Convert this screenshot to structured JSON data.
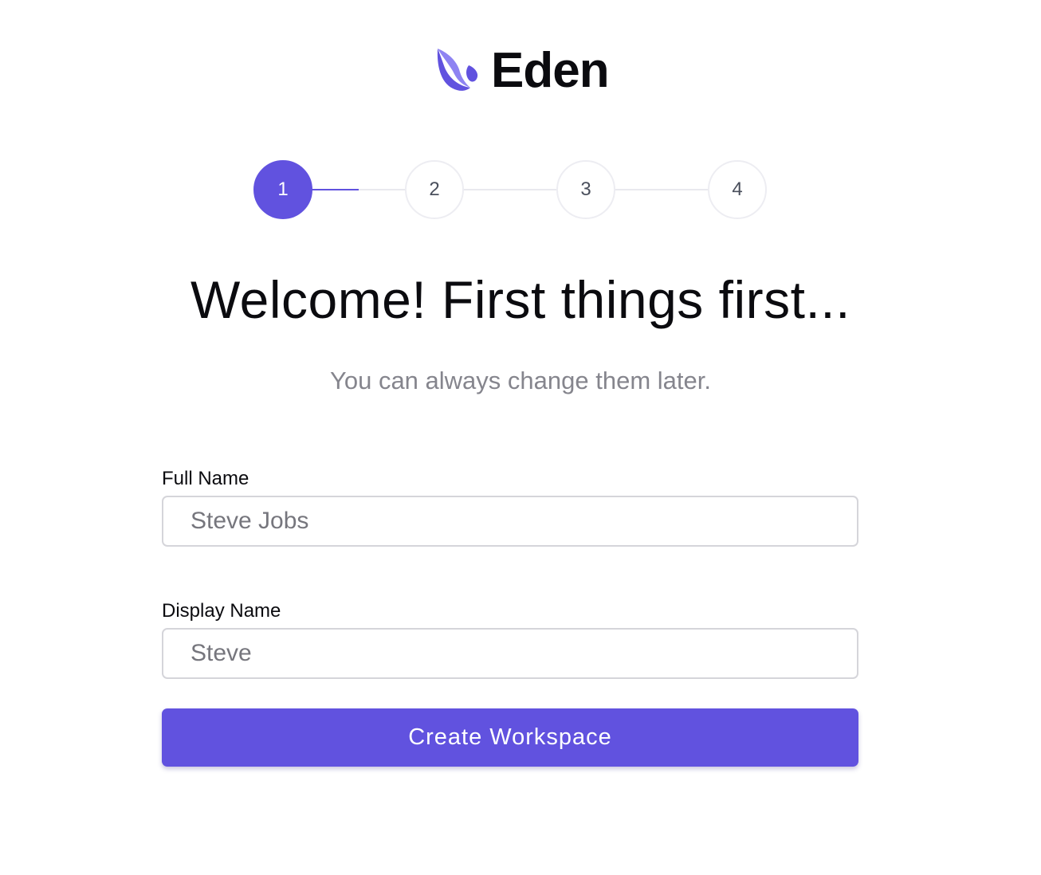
{
  "brand": {
    "name": "Eden",
    "logo_icon": "eden-leaf-icon",
    "accent_color": "#6152df"
  },
  "stepper": {
    "steps": [
      "1",
      "2",
      "3",
      "4"
    ],
    "current_step": 1
  },
  "heading": "Welcome! First things first...",
  "subtitle": "You can always change them later.",
  "form": {
    "full_name": {
      "label": "Full Name",
      "placeholder": "Steve Jobs",
      "value": ""
    },
    "display_name": {
      "label": "Display Name",
      "placeholder": "Steve",
      "value": ""
    },
    "submit_label": "Create Workspace"
  }
}
